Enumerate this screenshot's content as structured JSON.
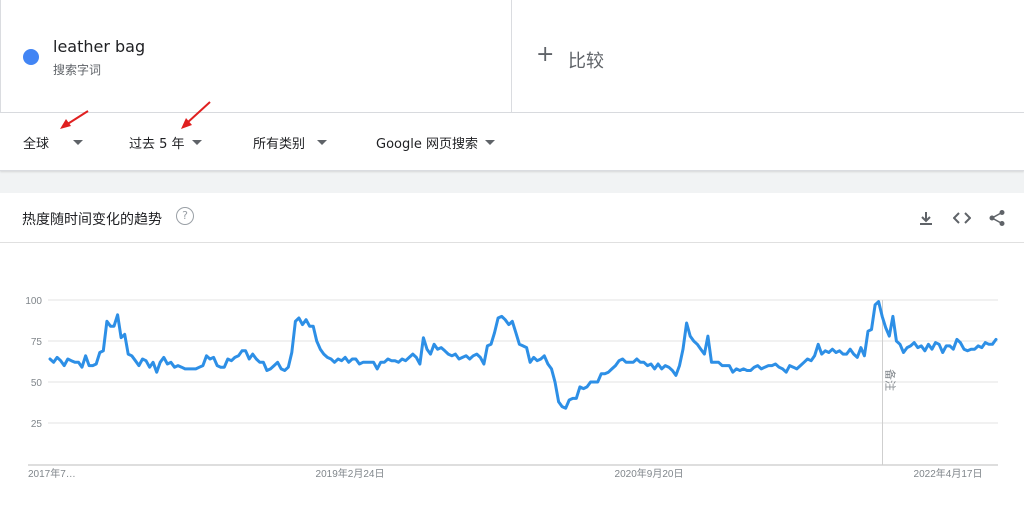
{
  "term": {
    "name": "leather bag",
    "subtitle": "搜索字词",
    "color": "#4285f4"
  },
  "compare": {
    "label": "比较"
  },
  "filters": {
    "region": "全球",
    "time": "过去 5 年",
    "category": "所有类别",
    "search_type": "Google 网页搜索"
  },
  "chart_card": {
    "title": "热度随时间变化的趋势",
    "tools": [
      "download-icon",
      "embed-code-icon",
      "share-icon"
    ]
  },
  "chart_data": {
    "type": "line",
    "yticks": [
      25,
      50,
      75,
      100
    ],
    "ylim": [
      0,
      100
    ],
    "xlabels": [
      "2017年7…",
      "2019年2月24日",
      "2020年9月20日",
      "2022年4月17日"
    ],
    "annotation": {
      "label": "备注",
      "index": 234
    },
    "line_color": "#2d8fe6",
    "series": [
      {
        "values": [
          64,
          62,
          65,
          63,
          60,
          64,
          63,
          62,
          62,
          59,
          66,
          60,
          60,
          61,
          68,
          69,
          87,
          84,
          84,
          91,
          77,
          79,
          67,
          66,
          63,
          60,
          64,
          63,
          59,
          62,
          56,
          62,
          65,
          61,
          62,
          59,
          60,
          59,
          58,
          58,
          58,
          58,
          59,
          60,
          66,
          64,
          65,
          60,
          59,
          59,
          64,
          63,
          65,
          66,
          69,
          69,
          64,
          67,
          64,
          62,
          62,
          57,
          58,
          60,
          62,
          58,
          57,
          59,
          68,
          87,
          89,
          85,
          88,
          84,
          84,
          75,
          70,
          67,
          65,
          64,
          62,
          64,
          63,
          65,
          62,
          64,
          64,
          61,
          62,
          62,
          62,
          62,
          58,
          62,
          62,
          64,
          63,
          63,
          62,
          64,
          63,
          65,
          67,
          65,
          61,
          77,
          70,
          67,
          73,
          70,
          71,
          69,
          67,
          66,
          67,
          64,
          65,
          66,
          64,
          66,
          67,
          65,
          61,
          72,
          73,
          80,
          89,
          90,
          88,
          85,
          87,
          80,
          73,
          72,
          71,
          62,
          65,
          63,
          64,
          66,
          61,
          58,
          50,
          38,
          35,
          34,
          39,
          40,
          40,
          47,
          46,
          47,
          50,
          50,
          50,
          55,
          55,
          56,
          58,
          60,
          63,
          64,
          62,
          62,
          62,
          64,
          62,
          62,
          60,
          61,
          58,
          61,
          58,
          60,
          59,
          57,
          54,
          60,
          70,
          86,
          78,
          75,
          73,
          70,
          67,
          78,
          62,
          62,
          62,
          60,
          60,
          60,
          56,
          58,
          57,
          58,
          57,
          57,
          59,
          60,
          58,
          59,
          60,
          60,
          61,
          59,
          58,
          56,
          60,
          59,
          58,
          60,
          62,
          64,
          63,
          66,
          73,
          67,
          69,
          68,
          70,
          68,
          69,
          67,
          67,
          70,
          67,
          65,
          71,
          66,
          81,
          82,
          97,
          99,
          90,
          83,
          78,
          90,
          75,
          73,
          68,
          71,
          72,
          74,
          71,
          72,
          69,
          73,
          70,
          74,
          73,
          68,
          72,
          72,
          70,
          76,
          74,
          70,
          69,
          70,
          70,
          72,
          71,
          74,
          73,
          73,
          76
        ]
      }
    ]
  }
}
